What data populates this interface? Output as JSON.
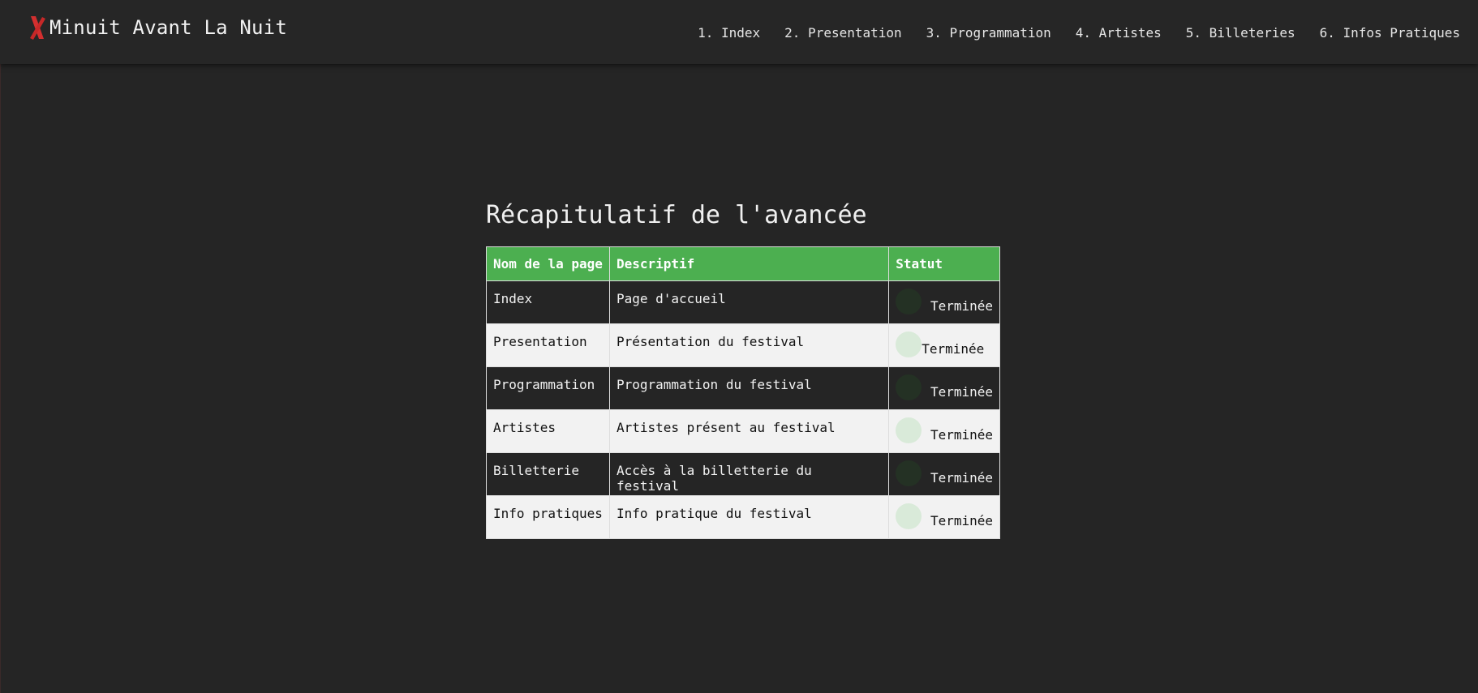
{
  "header": {
    "brand_icon": "red-x-icon",
    "brand_icon_color": "#d32f2f",
    "brand_name": "Minuit Avant La Nuit",
    "nav": [
      {
        "label": "1. Index"
      },
      {
        "label": "2. Presentation"
      },
      {
        "label": "3. Programmation"
      },
      {
        "label": "4. Artistes"
      },
      {
        "label": "5. Billeteries"
      },
      {
        "label": "6. Infos Pratiques"
      }
    ]
  },
  "main": {
    "title": "Récapitulatif de l'avancée",
    "table": {
      "header_color": "#4caf50",
      "columns": [
        "Nom de la page",
        "Descriptif",
        "Statut"
      ],
      "rows": [
        {
          "name": "Index",
          "description": "Page d'accueil",
          "status": "Terminée"
        },
        {
          "name": "Presentation",
          "description": "Présentation du festival",
          "status": "Terminée"
        },
        {
          "name": "Programmation",
          "description": "Programmation du festival",
          "status": "Terminée"
        },
        {
          "name": "Artistes",
          "description": "Artistes présent au festival",
          "status": "Terminée"
        },
        {
          "name": "Billetterie",
          "description": "Accès à la billetterie du festival",
          "status": "Terminée"
        },
        {
          "name": "Info pratiques",
          "description": "Info pratique du festival",
          "status": "Terminée"
        }
      ]
    }
  }
}
